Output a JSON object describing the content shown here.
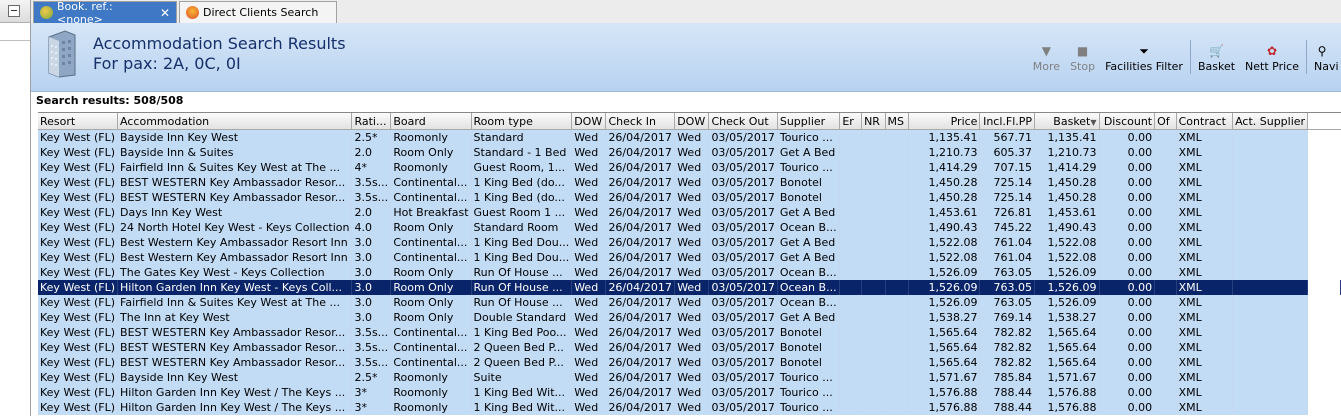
{
  "tabs": [
    {
      "label": "Book. ref.: <none>",
      "icon": "palm-tree-icon",
      "active": true
    },
    {
      "label": "Direct Clients Search",
      "icon": "star-icon",
      "active": false
    }
  ],
  "header": {
    "title": "Accommodation Search Results",
    "subtitle": "For pax: 2A, 0C, 0I"
  },
  "toolbar": {
    "more": "More",
    "stop": "Stop",
    "facilities": "Facilities Filter",
    "basket": "Basket",
    "nett_price": "Nett Price",
    "navi": "Navi"
  },
  "results_label": "Search results: 508/508",
  "columns": [
    "Resort",
    "Accommodation",
    "Rati...",
    "Board",
    "Room type",
    "DOW",
    "Check In",
    "DOW",
    "Check Out",
    "Supplier",
    "Er",
    "NR",
    "MS",
    "Price",
    "Incl.Fl.PP",
    "Basket",
    "Discount",
    "Of",
    "Contract",
    "Act. Supplier"
  ],
  "rows": [
    [
      "Key West (FL)",
      "Bayside Inn Key West",
      "2.5*",
      "Roomonly",
      "Standard",
      "Wed",
      "26/04/2017",
      "Wed",
      "03/05/2017",
      "Tourico ...",
      "",
      "",
      "",
      "1,135.41",
      "567.71",
      "1,135.41",
      "0.00",
      "",
      "XML",
      ""
    ],
    [
      "Key West (FL)",
      "Bayside Inn & Suites",
      "2.0",
      "Room Only",
      "Standard - 1 Bed",
      "Wed",
      "26/04/2017",
      "Wed",
      "03/05/2017",
      "Get A Bed",
      "",
      "",
      "",
      "1,210.73",
      "605.37",
      "1,210.73",
      "0.00",
      "",
      "XML",
      ""
    ],
    [
      "Key West (FL)",
      "Fairfield Inn & Suites Key West at The ...",
      "4*",
      "Roomonly",
      "Guest Room, 1...",
      "Wed",
      "26/04/2017",
      "Wed",
      "03/05/2017",
      "Tourico ...",
      "",
      "",
      "",
      "1,414.29",
      "707.15",
      "1,414.29",
      "0.00",
      "",
      "XML",
      ""
    ],
    [
      "Key West (FL)",
      "BEST WESTERN Key Ambassador Resor...",
      "3.5s...",
      "Continental...",
      "1 King Bed (do...",
      "Wed",
      "26/04/2017",
      "Wed",
      "03/05/2017",
      "Bonotel",
      "",
      "",
      "",
      "1,450.28",
      "725.14",
      "1,450.28",
      "0.00",
      "",
      "XML",
      ""
    ],
    [
      "Key West (FL)",
      "BEST WESTERN Key Ambassador Resor...",
      "3.5s...",
      "Continental...",
      "1 King Bed (do...",
      "Wed",
      "26/04/2017",
      "Wed",
      "03/05/2017",
      "Bonotel",
      "",
      "",
      "",
      "1,450.28",
      "725.14",
      "1,450.28",
      "0.00",
      "",
      "XML",
      ""
    ],
    [
      "Key West (FL)",
      "Days Inn Key West",
      "2.0",
      "Hot Breakfast",
      "Guest Room 1 ...",
      "Wed",
      "26/04/2017",
      "Wed",
      "03/05/2017",
      "Get A Bed",
      "",
      "",
      "",
      "1,453.61",
      "726.81",
      "1,453.61",
      "0.00",
      "",
      "XML",
      ""
    ],
    [
      "Key West (FL)",
      "24 North Hotel Key West - Keys Collection",
      "4.0",
      "Room Only",
      "Standard Room",
      "Wed",
      "26/04/2017",
      "Wed",
      "03/05/2017",
      "Ocean B...",
      "",
      "",
      "",
      "1,490.43",
      "745.22",
      "1,490.43",
      "0.00",
      "",
      "XML",
      ""
    ],
    [
      "Key West (FL)",
      "Best Western Key Ambassador Resort Inn",
      "3.0",
      "Continental...",
      "1 King Bed Dou...",
      "Wed",
      "26/04/2017",
      "Wed",
      "03/05/2017",
      "Get A Bed",
      "",
      "",
      "",
      "1,522.08",
      "761.04",
      "1,522.08",
      "0.00",
      "",
      "XML",
      ""
    ],
    [
      "Key West (FL)",
      "Best Western Key Ambassador Resort Inn",
      "3.0",
      "Continental...",
      "1 King Bed Dou...",
      "Wed",
      "26/04/2017",
      "Wed",
      "03/05/2017",
      "Get A Bed",
      "",
      "",
      "",
      "1,522.08",
      "761.04",
      "1,522.08",
      "0.00",
      "",
      "XML",
      ""
    ],
    [
      "Key West (FL)",
      "The Gates Key West - Keys Collection",
      "3.0",
      "Room Only",
      "Run Of House ...",
      "Wed",
      "26/04/2017",
      "Wed",
      "03/05/2017",
      "Ocean B...",
      "",
      "",
      "",
      "1,526.09",
      "763.05",
      "1,526.09",
      "0.00",
      "",
      "XML",
      ""
    ],
    [
      "Key West (FL)",
      "Hilton Garden Inn Key West - Keys Coll...",
      "3.0",
      "Room Only",
      "Run Of House ...",
      "Wed",
      "26/04/2017",
      "Wed",
      "03/05/2017",
      "Ocean B...",
      "",
      "",
      "",
      "1,526.09",
      "763.05",
      "1,526.09",
      "0.00",
      "",
      "XML",
      ""
    ],
    [
      "Key West (FL)",
      "Fairfield Inn & Suites Key West at The ...",
      "3.0",
      "Room Only",
      "Run Of House ...",
      "Wed",
      "26/04/2017",
      "Wed",
      "03/05/2017",
      "Ocean B...",
      "",
      "",
      "",
      "1,526.09",
      "763.05",
      "1,526.09",
      "0.00",
      "",
      "XML",
      ""
    ],
    [
      "Key West (FL)",
      "The Inn at Key West",
      "3.0",
      "Room Only",
      "Double Standard",
      "Wed",
      "26/04/2017",
      "Wed",
      "03/05/2017",
      "Get A Bed",
      "",
      "",
      "",
      "1,538.27",
      "769.14",
      "1,538.27",
      "0.00",
      "",
      "XML",
      ""
    ],
    [
      "Key West (FL)",
      "BEST WESTERN Key Ambassador Resor...",
      "3.5s...",
      "Continental...",
      "1 King Bed Poo...",
      "Wed",
      "26/04/2017",
      "Wed",
      "03/05/2017",
      "Bonotel",
      "",
      "",
      "",
      "1,565.64",
      "782.82",
      "1,565.64",
      "0.00",
      "",
      "XML",
      ""
    ],
    [
      "Key West (FL)",
      "BEST WESTERN Key Ambassador Resor...",
      "3.5s...",
      "Continental...",
      "2 Queen Bed P...",
      "Wed",
      "26/04/2017",
      "Wed",
      "03/05/2017",
      "Bonotel",
      "",
      "",
      "",
      "1,565.64",
      "782.82",
      "1,565.64",
      "0.00",
      "",
      "XML",
      ""
    ],
    [
      "Key West (FL)",
      "BEST WESTERN Key Ambassador Resor...",
      "3.5s...",
      "Continental...",
      "2 Queen Bed P...",
      "Wed",
      "26/04/2017",
      "Wed",
      "03/05/2017",
      "Bonotel",
      "",
      "",
      "",
      "1,565.64",
      "782.82",
      "1,565.64",
      "0.00",
      "",
      "XML",
      ""
    ],
    [
      "Key West (FL)",
      "Bayside Inn Key West",
      "2.5*",
      "Roomonly",
      "Suite",
      "Wed",
      "26/04/2017",
      "Wed",
      "03/05/2017",
      "Tourico ...",
      "",
      "",
      "",
      "1,571.67",
      "785.84",
      "1,571.67",
      "0.00",
      "",
      "XML",
      ""
    ],
    [
      "Key West (FL)",
      "Hilton Garden Inn Key West / The Keys ...",
      "3*",
      "Roomonly",
      "1 King Bed Wit...",
      "Wed",
      "26/04/2017",
      "Wed",
      "03/05/2017",
      "Tourico ...",
      "",
      "",
      "",
      "1,576.88",
      "788.44",
      "1,576.88",
      "0.00",
      "",
      "XML",
      ""
    ],
    [
      "Key West (FL)",
      "Hilton Garden Inn Key West / The Keys ...",
      "3*",
      "Roomonly",
      "1 King Bed Wit...",
      "Wed",
      "26/04/2017",
      "Wed",
      "03/05/2017",
      "Tourico ...",
      "",
      "",
      "",
      "1,576.88",
      "788.44",
      "1,576.88",
      "0.00",
      "",
      "XML",
      ""
    ]
  ],
  "selected_row": 10,
  "sorted_column": "Basket",
  "colors": {
    "row_bg": "#c3dcf6",
    "selected_bg": "#0a246a",
    "header_bg": "#b8d2f0",
    "title_color": "#15306b"
  }
}
